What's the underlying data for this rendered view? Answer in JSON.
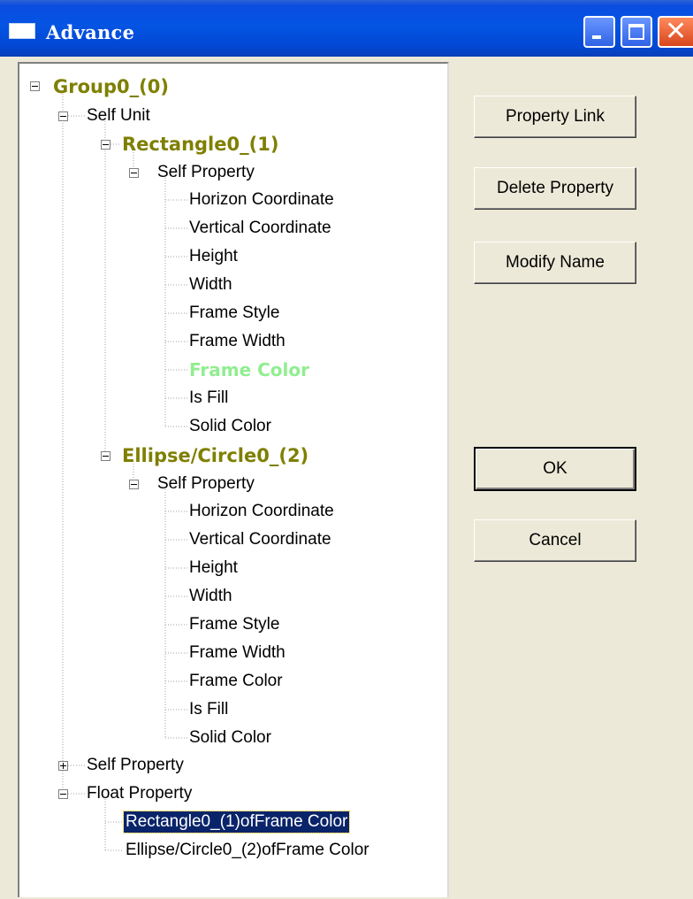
{
  "window": {
    "title": "Advance",
    "buttons": {
      "minimize": "minimize-icon",
      "maximize": "maximize-icon",
      "close": "close-icon"
    }
  },
  "tree": {
    "root": "Group0_(0)",
    "self_unit": "Self Unit",
    "rectangle": {
      "label": "Rectangle0_(1)",
      "self_property": "Self Property",
      "properties": [
        "Horizon Coordinate",
        "Vertical Coordinate",
        "Height",
        "Width",
        "Frame Style",
        "Frame Width",
        "Frame Color",
        "Is Fill",
        "Solid Color"
      ]
    },
    "ellipse": {
      "label": "Ellipse/Circle0_(2)",
      "self_property": "Self Property",
      "properties": [
        "Horizon Coordinate",
        "Vertical Coordinate",
        "Height",
        "Width",
        "Frame Style",
        "Frame Width",
        "Frame Color",
        "Is Fill",
        "Solid Color"
      ]
    },
    "group_self_property": "Self Property",
    "float_property": "Float Property",
    "float_items": [
      "Rectangle0_(1)ofFrame Color",
      "Ellipse/Circle0_(2)ofFrame Color"
    ],
    "selected_item": "Rectangle0_(1)ofFrame Color",
    "highlighted_property": "Frame Color"
  },
  "buttons": {
    "property_link": "Property Link",
    "delete_property": "Delete Property",
    "modify_name": "Modify Name",
    "ok": "OK",
    "cancel": "Cancel"
  },
  "colors": {
    "titlebar": "#0554e3",
    "group_node": "#7f7f00",
    "highlight_node": "#90ee90",
    "selection": "#0a246a",
    "dialog_bg": "#ece9d8"
  }
}
